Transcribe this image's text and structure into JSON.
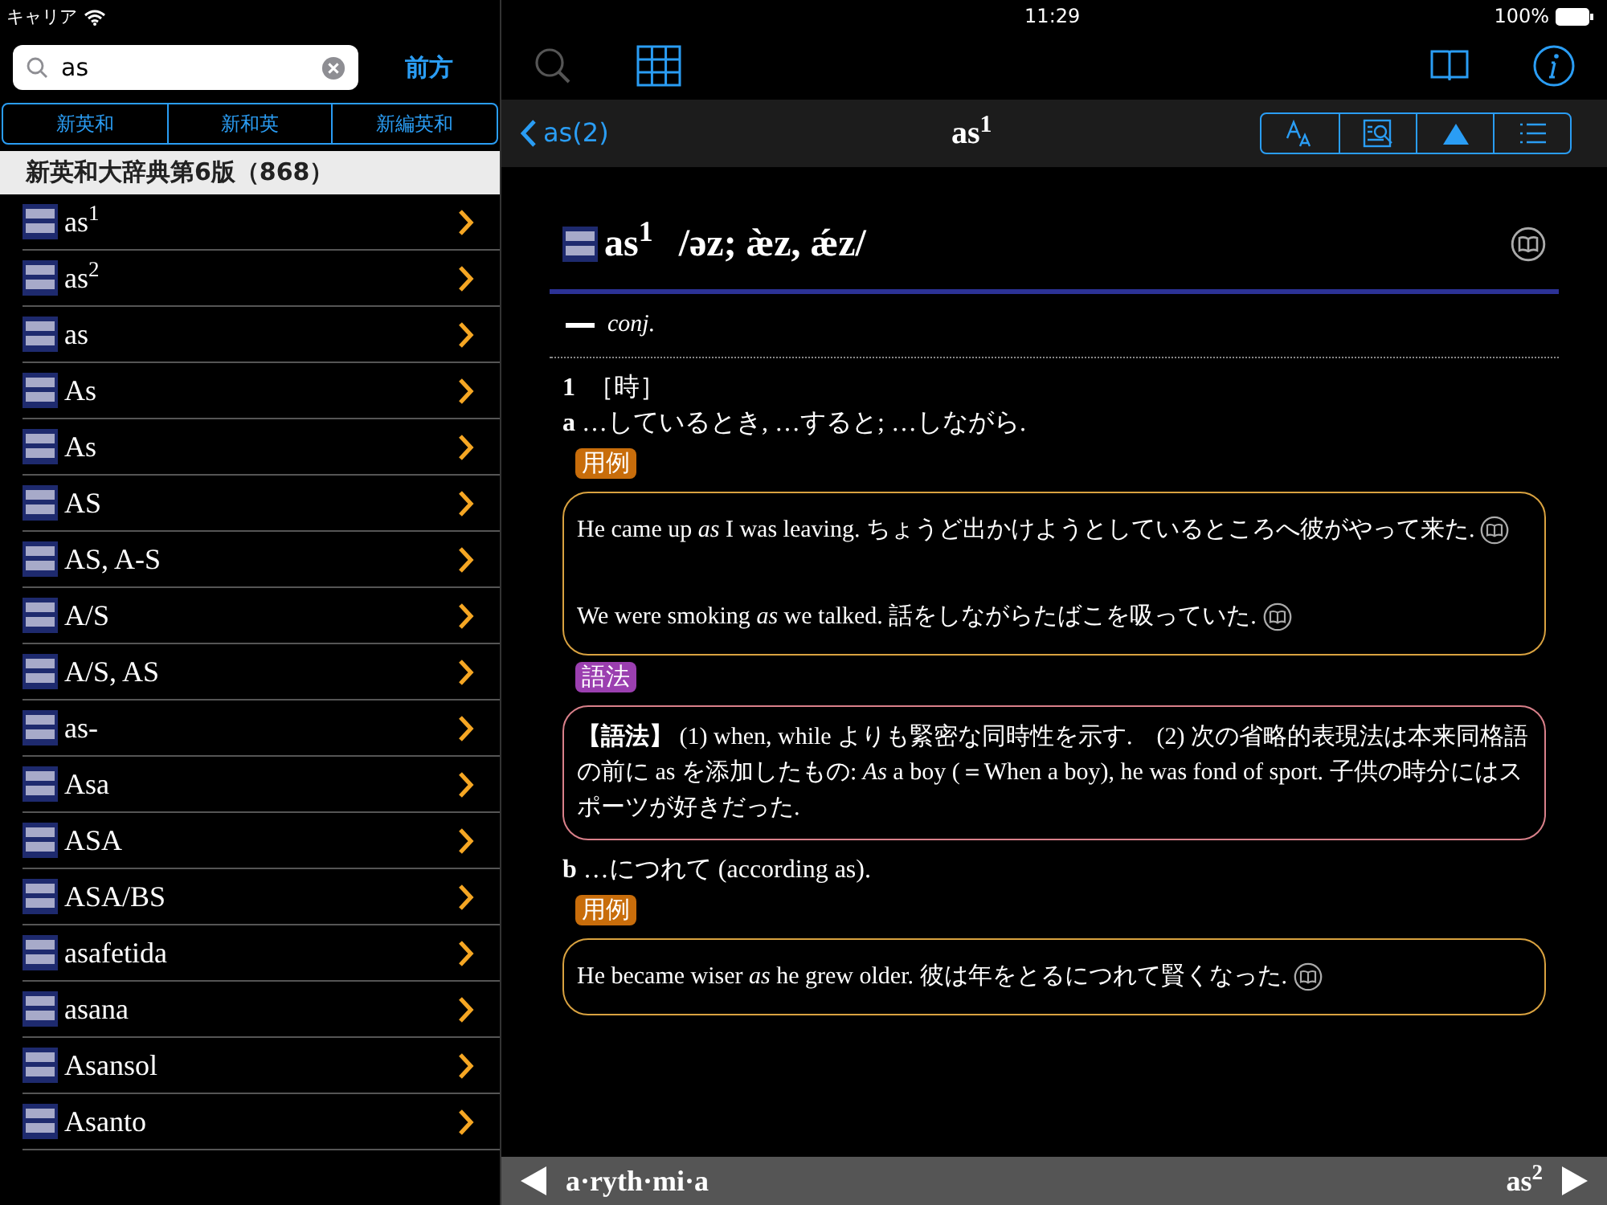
{
  "status_bar": {
    "carrier": "キャリア",
    "time": "11:29",
    "battery": "100%"
  },
  "search": {
    "value": "as"
  },
  "direction_button": "前方",
  "dictionary_tabs": [
    {
      "label": "新英和",
      "selected": false
    },
    {
      "label": "新和英",
      "selected": false
    },
    {
      "label": "新編英和",
      "selected": false
    }
  ],
  "results_header": "新英和大辞典第6版（868）",
  "results": [
    {
      "word": "as$^{1}$"
    },
    {
      "word": "as$^{2}$"
    },
    {
      "word": "as"
    },
    {
      "word": "As"
    },
    {
      "word": "As"
    },
    {
      "word": "AS"
    },
    {
      "word": "AS, A-S"
    },
    {
      "word": "A/S"
    },
    {
      "word": "A/S, AS"
    },
    {
      "word": "as-"
    },
    {
      "word": "Asa"
    },
    {
      "word": "ASA"
    },
    {
      "word": "ASA/BS"
    },
    {
      "word": "asafetida"
    },
    {
      "word": "asana"
    },
    {
      "word": "Asansol"
    },
    {
      "word": "Asanto"
    }
  ],
  "nav": {
    "back": "as(2)",
    "title": "as$^{1}$"
  },
  "entry": {
    "headword": "as$^{1}$",
    "pronunciation": "/əz; æ̀z, ǽz/",
    "part_of_speech": "conj.",
    "sense_number": "1",
    "sense_label": "［時］",
    "subsenses": [
      {
        "letter": "a",
        "gloss": "…しているとき, …すると; …しながら.",
        "blocks": [
          {
            "kind": "examples",
            "tag": "用例",
            "items": [
              "He came up *as* I was leaving. ちょうど出かけようとしているところへ彼がやって来た.",
              "We were smoking *as* we talked. 話をしながらたばこを吸っていた."
            ]
          },
          {
            "kind": "usage",
            "tag": "語法",
            "text": "**【語法】** (1) when, while よりも緊密な同時性を示す.　(2) 次の省略的表現法は本来同格語の前に as を添加したもの: *As* a boy (＝When a boy), he was fond of sport. 子供の時分にはスポーツが好きだった."
          }
        ]
      },
      {
        "letter": "b",
        "gloss": "…につれて (according as).",
        "blocks": [
          {
            "kind": "examples",
            "tag": "用例",
            "items": [
              "He became wiser *as* he grew older. 彼は年をとるにつれて賢くなった."
            ]
          }
        ]
      }
    ]
  },
  "footer": {
    "previous": "a·ryth·mi·a",
    "next": "as$^{2}$"
  }
}
